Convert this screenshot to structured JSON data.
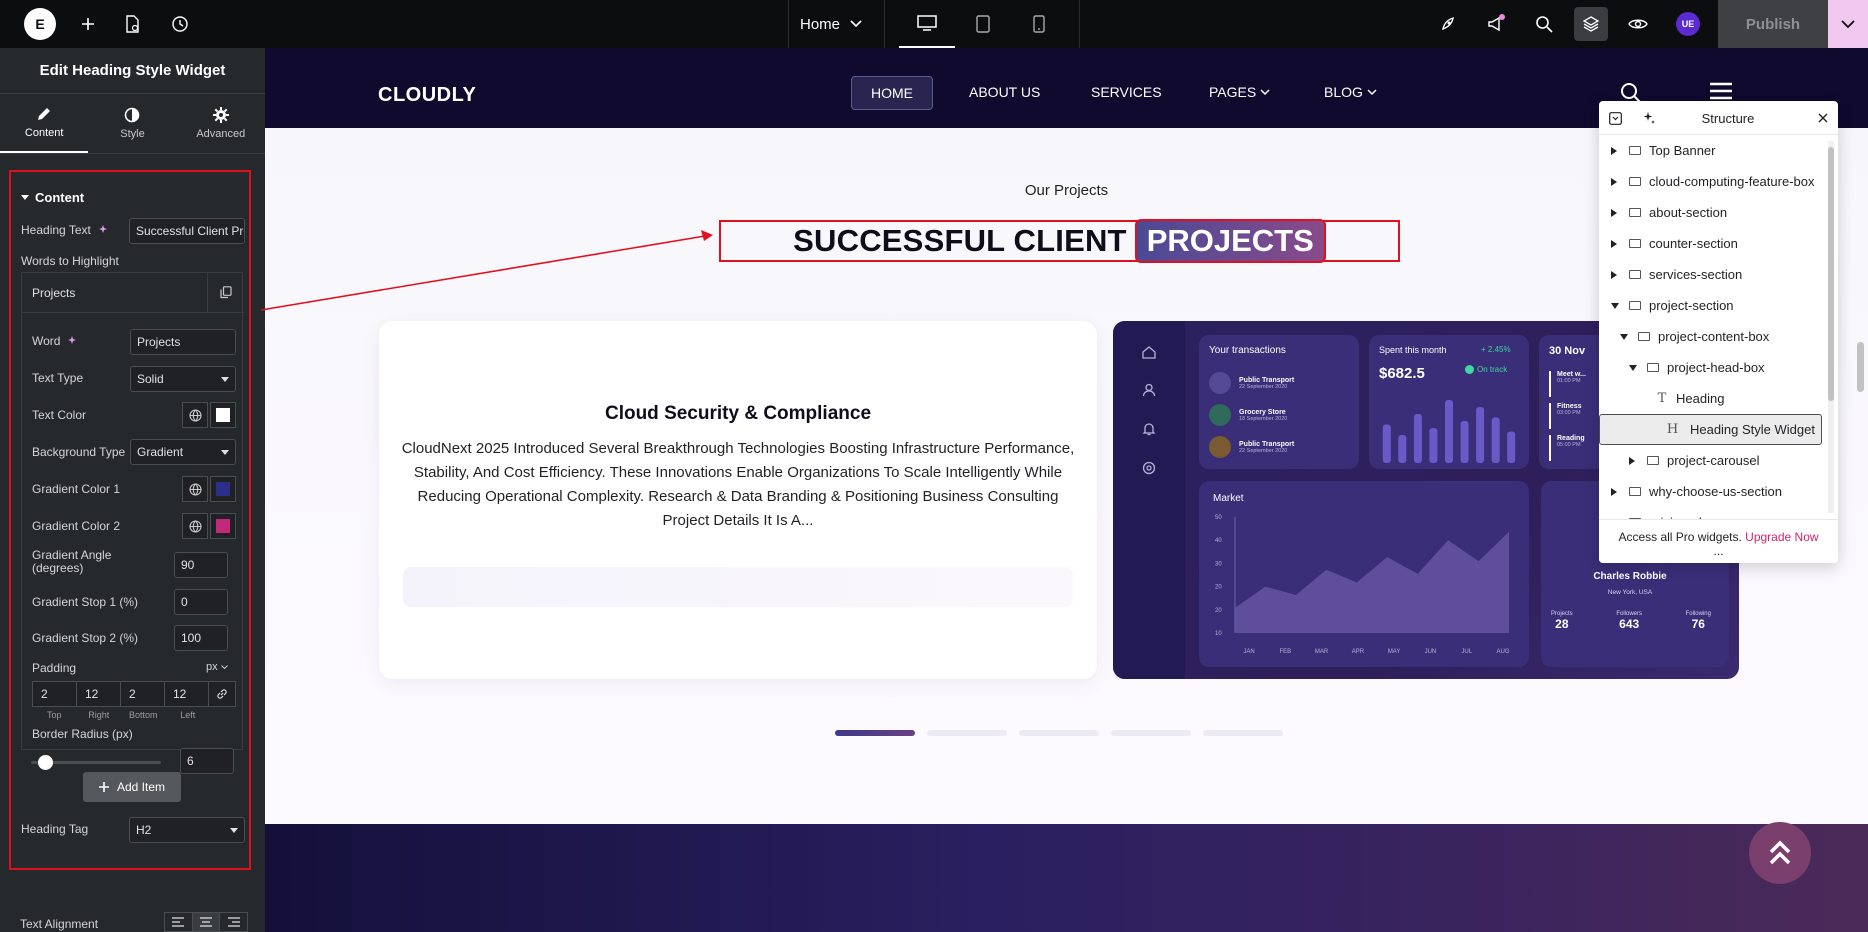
{
  "topbar": {
    "logo": "E",
    "page_selector": "Home",
    "publish_label": "Publish",
    "user_initials": "UE"
  },
  "panel": {
    "title": "Edit Heading Style Widget",
    "tabs": [
      {
        "label": "Content",
        "icon": "pencil-icon"
      },
      {
        "label": "Style",
        "icon": "contrast-icon"
      },
      {
        "label": "Advanced",
        "icon": "gear-icon"
      }
    ],
    "section_title": "Content",
    "heading_text_label": "Heading Text",
    "heading_text_value": "Successful Client Projects",
    "words_label": "Words to Highlight",
    "item_title": "Projects",
    "word_label": "Word",
    "word_value": "Projects",
    "text_type_label": "Text Type",
    "text_type_value": "Solid",
    "text_color_label": "Text Color",
    "bg_type_label": "Background Type",
    "bg_type_value": "Gradient",
    "grad1_label": "Gradient Color 1",
    "grad2_label": "Gradient Color 2",
    "grad_angle_label": "Gradient Angle (degrees)",
    "grad_angle_value": "90",
    "stop1_label": "Gradient Stop 1 (%)",
    "stop1_value": "0",
    "stop2_label": "Gradient Stop 2 (%)",
    "stop2_value": "100",
    "padding_label": "Padding",
    "padding_unit": "px",
    "padding": [
      {
        "value": "2",
        "label": "Top"
      },
      {
        "value": "12",
        "label": "Right"
      },
      {
        "value": "2",
        "label": "Bottom"
      },
      {
        "value": "12",
        "label": "Left"
      }
    ],
    "radius_label": "Border Radius (px)",
    "radius_value": "6",
    "radius_fraction": 0.06,
    "add_item_label": "Add Item",
    "heading_tag_label": "Heading Tag",
    "heading_tag_value": "H2",
    "text_align_label": "Text Alignment",
    "colors": {
      "text": "#ffffff",
      "gradient1": "#2b2f8a",
      "gradient2": "#c2297a"
    }
  },
  "site": {
    "brand": "CLOUDLY",
    "nav": [
      "HOME",
      "ABOUT US",
      "SERVICES",
      "PAGES",
      "BLOG"
    ],
    "kicker": "Our Projects",
    "heading_plain": "SUCCESSFUL CLIENT",
    "heading_highlight": "PROJECTS",
    "card_title": "Cloud Security & Compliance",
    "card_body": "CloudNext 2025 Introduced Several Breakthrough Technologies Boosting Infrastructure Performance, Stability, And Cost Efficiency. These Innovations Enable Organizations To Scale Intelligently While Reducing Operational Complexity.   Research & Data   Branding & Positioning   Business Consulting Project Details It Is A...",
    "dashboard": {
      "transactions_title": "Your transactions",
      "transactions": [
        {
          "name": "Public Transport",
          "date": "22 September 2020"
        },
        {
          "name": "Grocery Store",
          "date": "18 September 2020"
        },
        {
          "name": "Public Transport",
          "date": "22 September 2020"
        }
      ],
      "spent_title": "Spent this month",
      "spent_delta": "+ 2.45%",
      "spent_value": "$682.5",
      "spent_status": "On track",
      "spent_bars": [
        0.55,
        0.4,
        0.7,
        0.5,
        0.9,
        0.6,
        0.8,
        0.65,
        0.45
      ],
      "date_title": "30 Nov",
      "schedule": [
        {
          "name": "Meet w...",
          "time": "01:00 PM"
        },
        {
          "name": "Fitness",
          "time": "03:00 PM"
        },
        {
          "name": "Reading",
          "time": "05:00 PM"
        }
      ],
      "market_title": "Market",
      "market_y": [
        "50",
        "40",
        "30",
        "20",
        "20",
        "10"
      ],
      "market_x": [
        "JAN",
        "FEB",
        "MAR",
        "APR",
        "MAY",
        "JUN",
        "JUL",
        "AUG"
      ],
      "market_values": [
        12,
        22,
        18,
        30,
        24,
        36,
        28,
        44,
        34,
        48
      ],
      "profile_name": "Charles Robbie",
      "profile_location": "New York, USA",
      "stats": [
        {
          "label": "Projects",
          "value": "28"
        },
        {
          "label": "Followers",
          "value": "643"
        },
        {
          "label": "Following",
          "value": "76"
        }
      ]
    }
  },
  "structure": {
    "title": "Structure",
    "items": [
      {
        "label": "Top Banner",
        "level": 0,
        "expand": "right",
        "icon": "container-icon"
      },
      {
        "label": "cloud-computing-feature-box",
        "level": 0,
        "expand": "right",
        "icon": "container-icon"
      },
      {
        "label": "about-section",
        "level": 0,
        "expand": "right",
        "icon": "container-icon"
      },
      {
        "label": "counter-section",
        "level": 0,
        "expand": "right",
        "icon": "container-icon"
      },
      {
        "label": "services-section",
        "level": 0,
        "expand": "right",
        "icon": "container-icon"
      },
      {
        "label": "project-section",
        "level": 0,
        "expand": "down",
        "icon": "container-icon"
      },
      {
        "label": "project-content-box",
        "level": 1,
        "expand": "down",
        "icon": "container-icon"
      },
      {
        "label": "project-head-box",
        "level": 2,
        "expand": "down",
        "icon": "container-icon"
      },
      {
        "label": "Heading",
        "level": 3,
        "expand": "none",
        "icon": "heading-t-icon"
      },
      {
        "label": "Heading Style Widget",
        "level": 3,
        "expand": "none",
        "icon": "heading-h-icon",
        "selected": true
      },
      {
        "label": "project-carousel",
        "level": 2,
        "expand": "right",
        "icon": "container-icon"
      },
      {
        "label": "why-choose-us-section",
        "level": 0,
        "expand": "right",
        "icon": "container-icon"
      },
      {
        "label": "pricing-plan",
        "level": 0,
        "expand": "right",
        "icon": "container-icon"
      }
    ],
    "promo_text": "Access all Pro widgets.",
    "promo_link": "Upgrade Now",
    "more": "..."
  }
}
